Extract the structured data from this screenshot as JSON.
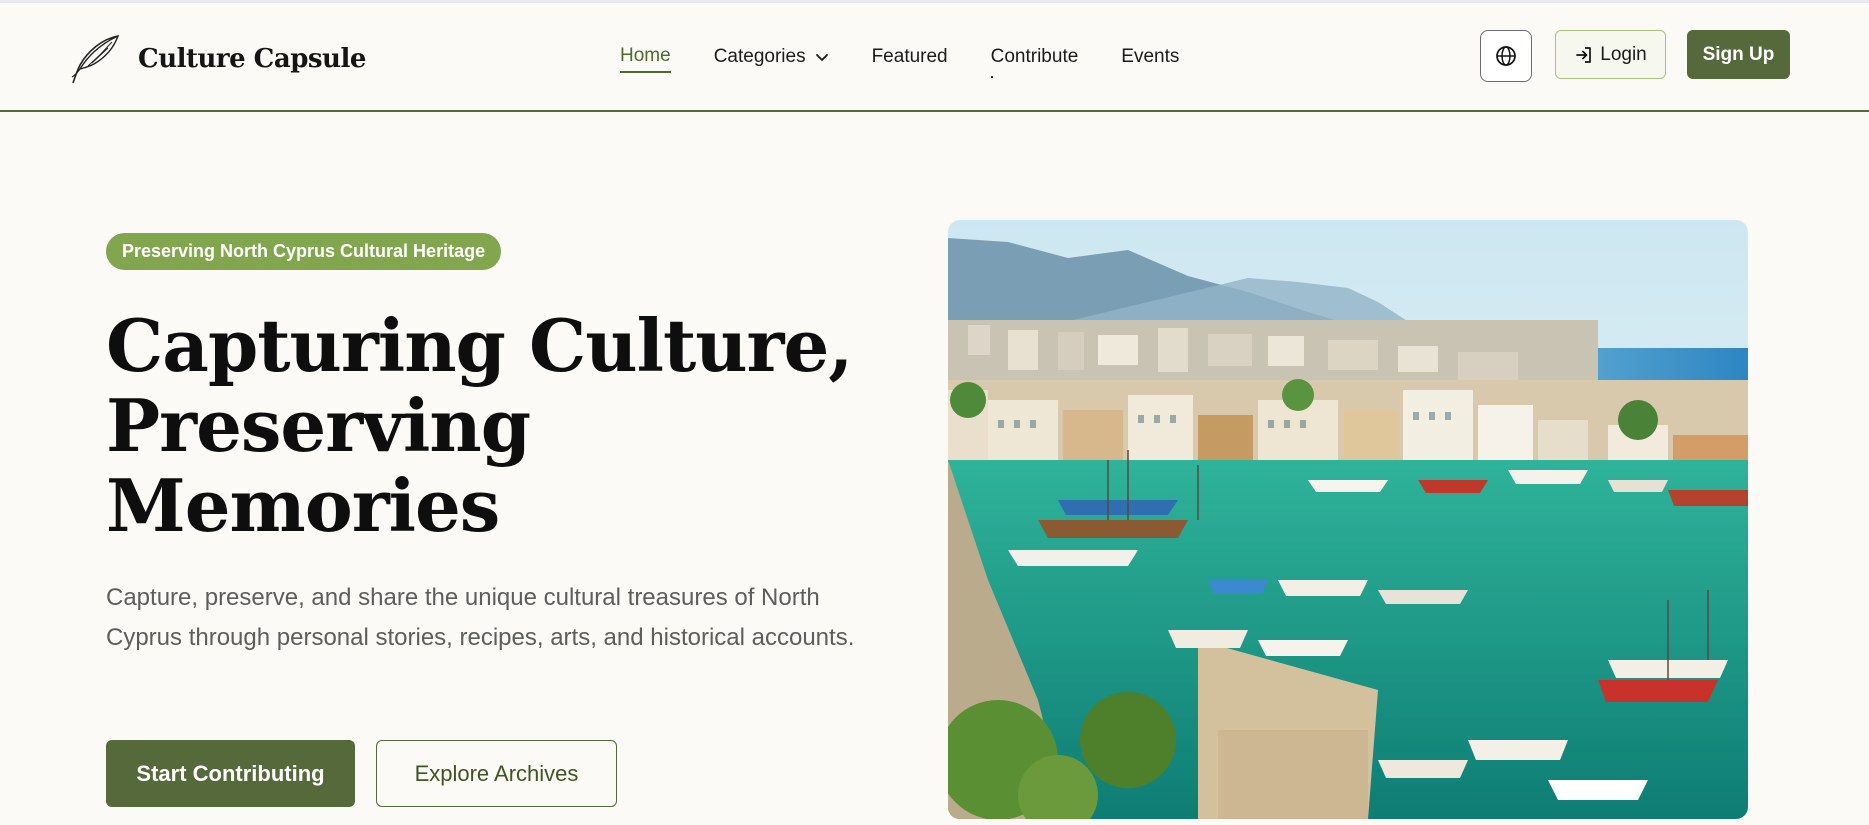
{
  "brand": {
    "name": "Culture Capsule",
    "logo_icon": "quill-feather-icon"
  },
  "nav": {
    "items": [
      {
        "label": "Home",
        "active": true
      },
      {
        "label": "Categories",
        "icon": "chevron-down-icon"
      },
      {
        "label": "Featured"
      },
      {
        "label": "Contribute"
      },
      {
        "label": "Events"
      }
    ]
  },
  "actions": {
    "language_icon": "globe-icon",
    "login_icon": "sign-in-icon",
    "login_label": "Login",
    "signup_label": "Sign Up"
  },
  "hero": {
    "badge": "Preserving North Cyprus Cultural Heritage",
    "title": "Capturing Culture, Preserving Memories",
    "subtitle": "Capture, preserve, and share the unique cultural treasures of North Cyprus through personal stories, recipes, arts, and historical accounts.",
    "primary_cta": "Start Contributing",
    "secondary_cta": "Explore Archives",
    "image_subject": "Kyrenia harbor with boats, waterfront buildings and mountains"
  },
  "colors": {
    "accent": "#56693a",
    "badge": "#82a64e",
    "background": "#fbfaf7",
    "text": "#0e0e0e",
    "muted_text": "#5d5d5d"
  }
}
